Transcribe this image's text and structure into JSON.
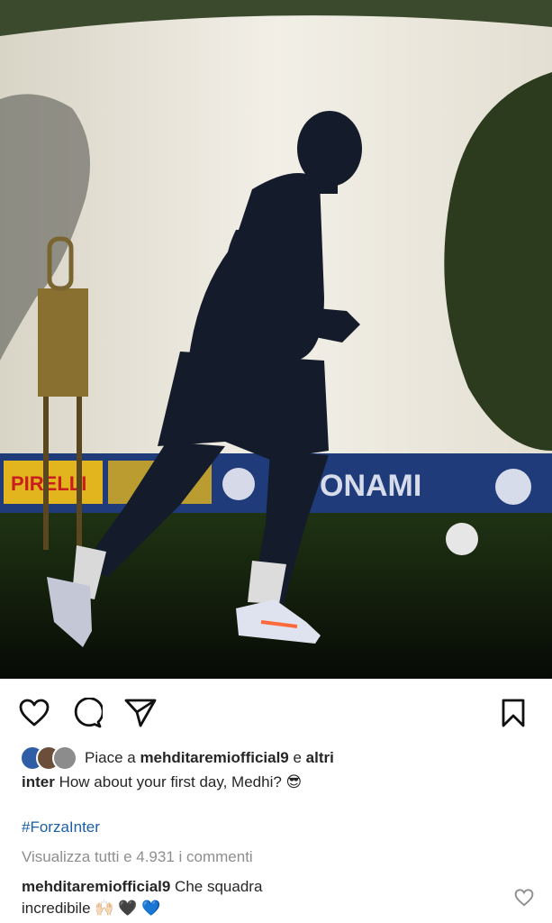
{
  "post": {
    "image_alt": "",
    "banner_text_left": "PIRELLI",
    "banner_text_right": "ONAMI"
  },
  "icons": {
    "like": "heart-outline-icon",
    "comment": "comment-bubble-icon",
    "share": "paper-plane-icon",
    "save": "bookmark-icon",
    "comment_like": "heart-outline-small-icon"
  },
  "likes": {
    "prefix": "Piace a ",
    "user": "mehditaremiofficial9",
    "connector": " e ",
    "others": "altri"
  },
  "caption": {
    "user": "inter",
    "text": " How about your first day, Medhi? 😎"
  },
  "hashtag": "#ForzaInter",
  "view_comments": "Visualizza tutti e 4.931 i commenti",
  "comment": {
    "user": "mehditaremiofficial9",
    "text_line1": " Che squadra",
    "text_line2": "incredibile 🙌🏻 🖤 💙"
  },
  "colors": {
    "text": "#262626",
    "muted": "#8e8e8e",
    "hashtag": "#1c5fa8"
  }
}
